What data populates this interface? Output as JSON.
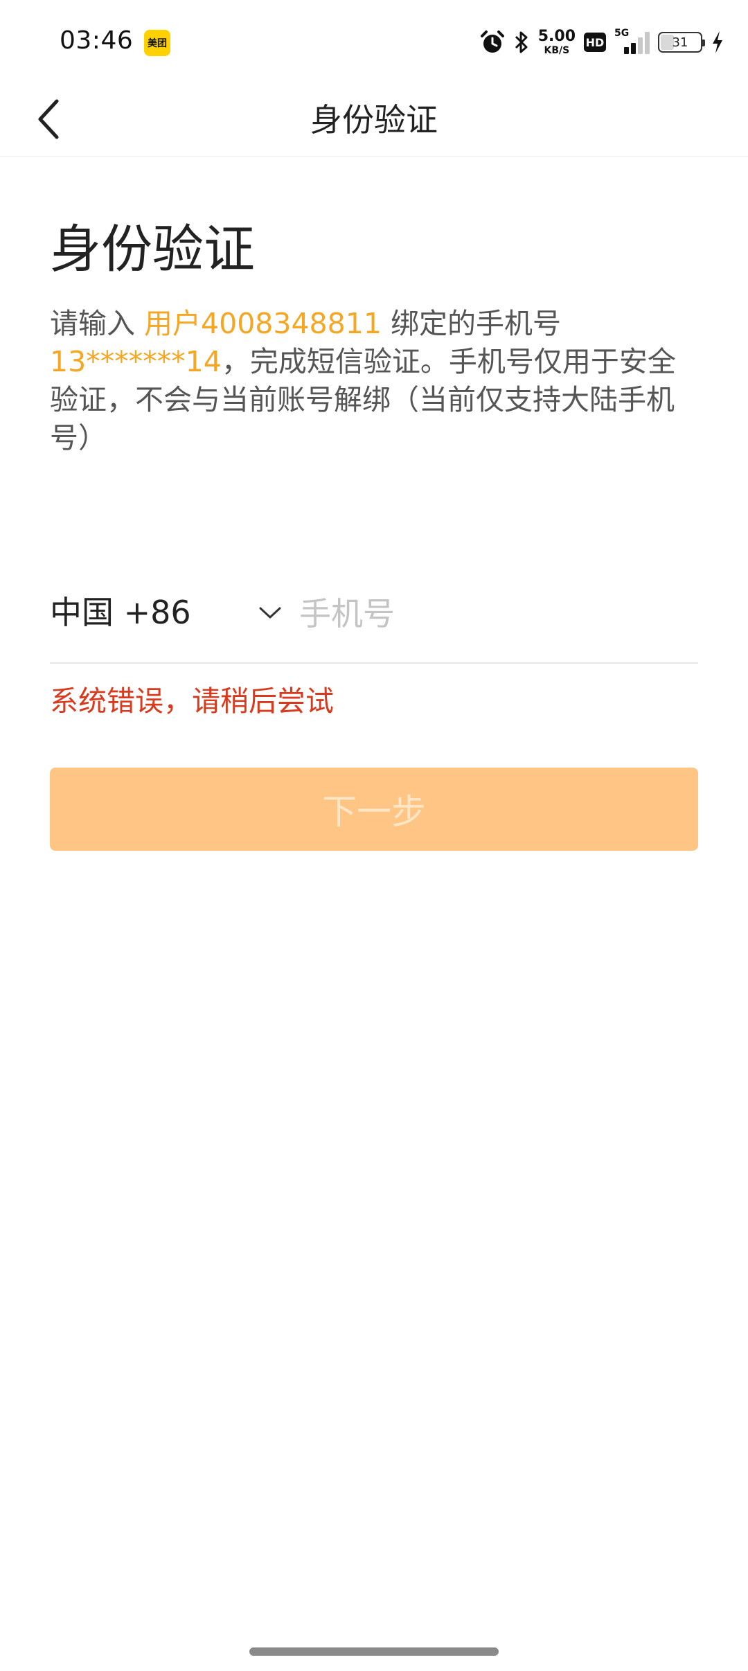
{
  "status_bar": {
    "time": "03:46",
    "app_badge": "美团",
    "net_speed_value": "5.00",
    "net_speed_unit": "KB/S",
    "hd_label": "HD",
    "network_type": "5G",
    "battery_level": "31"
  },
  "nav": {
    "title": "身份验证",
    "back_icon": "chevron-left-icon"
  },
  "main": {
    "heading": "身份验证",
    "instruction_prefix": "请输入 ",
    "account_label": "用户4008348811",
    "instruction_mid": " 绑定的手机号",
    "masked_phone": "13*******14",
    "instruction_suffix": "，完成短信验证。手机号仅用于安全验证，不会与当前账号解绑（当前仅支持大陆手机号）",
    "country_code": "中国 +86",
    "phone_placeholder": "手机号",
    "phone_value": "",
    "error_message": "系统错误，请稍后尝试",
    "next_button_label": "下一步"
  },
  "colors": {
    "highlight": "#F5A623",
    "error": "#D9391C",
    "button_bg_disabled": "#FFC584",
    "button_text_disabled": "#FFE6C6"
  }
}
